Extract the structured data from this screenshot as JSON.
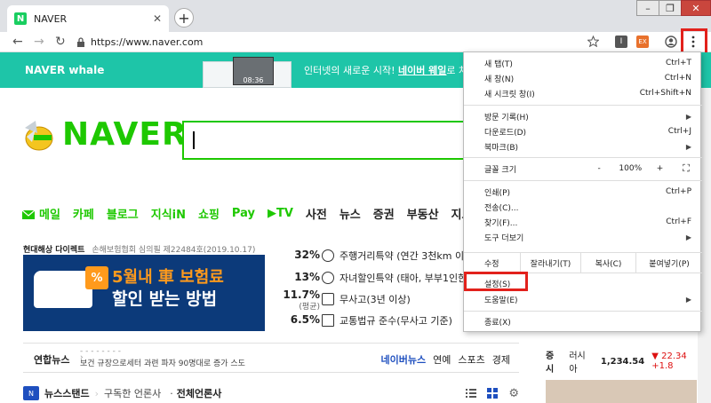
{
  "tab": {
    "favicon": "N",
    "title": "NAVER",
    "close": "✕",
    "new_tab": "+"
  },
  "window_controls": {
    "minimize": "–",
    "maximize": "❐",
    "close": "✕"
  },
  "toolbar": {
    "url": "https://www.naver.com",
    "back": "←",
    "forward": "→",
    "reload": "↻",
    "ext1": "I",
    "ext2": "EX"
  },
  "banner": {
    "logo": "NAVER whale",
    "text_prefix": "인터넷의 새로운 시작! ",
    "text_link": "네이버 웨일",
    "text_suffix": "로 차원",
    "preview_time": "08:36"
  },
  "brand": {
    "logo_text": "NAVER"
  },
  "nav": {
    "items": [
      "메일",
      "카페",
      "블로그",
      "지식iN",
      "쇼핑",
      "Pay",
      "▶TV",
      "사전",
      "뉴스",
      "증권",
      "부동산",
      "지도",
      "영"
    ]
  },
  "ad": {
    "sponsor": "현대해상 다이렉트",
    "fine_print": "손해보험협회 심의필 제22484호(2019.10.17)",
    "pct_badge": "%",
    "headline1": "5월내 車 보험료",
    "headline2": "할인 받는 방법",
    "stats": [
      {
        "value": "32%",
        "sub": "",
        "text": "주행거리특약 (연간 3천km 이하"
      },
      {
        "value": "13%",
        "sub": "",
        "text": "자녀할인특약 (태아, 부부1인한"
      },
      {
        "value": "11.7%",
        "sub": "(평균)",
        "text": "무사고(3년 이상)"
      },
      {
        "value": "6.5%",
        "sub": "",
        "text": "교통법규 준수(무사고 기준)"
      }
    ]
  },
  "news": {
    "label": "연합뉴스",
    "headline_top": "- - - - - - - -",
    "headline": "보건 규장으로세터 과련 파자 90명대로 증가 스도",
    "links": [
      "네이버뉴스",
      "연예",
      "스포츠",
      "경제"
    ],
    "stand_label": "뉴스스탠드",
    "stand_sub1": "구독한 언론사",
    "stand_sub2": "전체언론사"
  },
  "stock": {
    "label": "증시",
    "market": "러시아",
    "value": "1,234.54",
    "change": "▼ 22.34 +1.8"
  },
  "menu": {
    "new_tab": "새 탭(T)",
    "new_tab_sc": "Ctrl+T",
    "new_window": "새 창(N)",
    "new_window_sc": "Ctrl+N",
    "incognito": "새 시크릿 창(I)",
    "incognito_sc": "Ctrl+Shift+N",
    "history": "방문 기록(H)",
    "downloads": "다운로드(D)",
    "downloads_sc": "Ctrl+J",
    "bookmarks": "북마크(B)",
    "zoom": "글꼴 크기",
    "zoom_minus": "-",
    "zoom_value": "100%",
    "zoom_plus": "+",
    "fullscreen": "⛶",
    "print": "인쇄(P)",
    "print_sc": "Ctrl+P",
    "cast": "전송(C)...",
    "find": "찾기(F)...",
    "find_sc": "Ctrl+F",
    "more_tools": "도구 더보기",
    "edit": "수정",
    "cut": "잘라내기(T)",
    "copy": "복사(C)",
    "paste": "붙여넣기(P)",
    "settings": "설정(S)",
    "help": "도움말(E)",
    "exit": "종료(X)"
  },
  "colors": {
    "naver_green": "#1ec800",
    "whale_teal": "#1ec5a8",
    "highlight_red": "#e2211c",
    "ad_navy": "#0c3a7a"
  }
}
